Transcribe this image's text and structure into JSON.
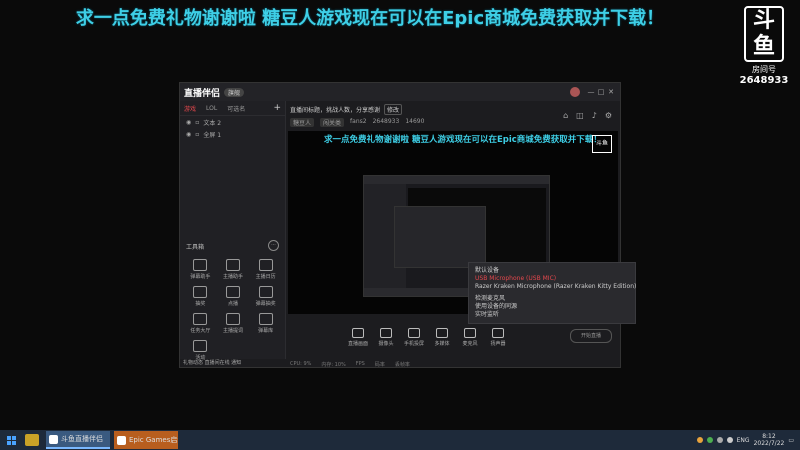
{
  "banner": "求一点免费礼物谢谢啦 糖豆人游戏现在可以在Epic商城免费获取并下载！",
  "logo": {
    "mark": "斗鱼",
    "room_label": "房间号",
    "room_number": "2648933"
  },
  "app": {
    "name": "直播伴侣",
    "badge": "旗舰",
    "left_tabs": [
      "游戏",
      "LOL",
      "可选名"
    ],
    "add": "+",
    "sources": [
      {
        "name": "文本 2"
      },
      {
        "name": "全屏 1"
      }
    ],
    "tools_title": "工具箱",
    "tools": [
      "弹幕助手",
      "主播助手",
      "主播日历",
      "抽奖",
      "点播",
      "弹幕抽奖",
      "任务大厅",
      "主播提词",
      "弹幕库",
      "活动",
      "",
      ""
    ],
    "left_notice": "礼物动态 直播间在线 通知",
    "info": {
      "title": "直播间标题，挑战人数，分享感谢",
      "edit": "修改",
      "tags": [
        "糖豆人",
        "闯关类"
      ],
      "meta": [
        "fans2",
        "2648933",
        "14690"
      ]
    },
    "preview_title": "求一点免费礼物谢谢啦 糖豆人游戏现在可以在Epic商城免费获取并下载！",
    "preview_logo": "斗鱼",
    "toolbar": [
      "直播画面",
      "摄像头",
      "手机投屏",
      "多媒体",
      "麦克风",
      "扬声器"
    ],
    "start_label": "开始直播",
    "status": [
      "CPU: 9%",
      "内存: 10%",
      "FPS",
      "码率",
      "丢帧率"
    ],
    "menu": {
      "items": [
        "默认设备",
        "USB Microphone (USB MIC)",
        "Razer Kraken Microphone (Razer Kraken Kitty Edition)",
        "",
        "检测麦克风",
        "使用设备的同源",
        "实时监听"
      ]
    }
  },
  "taskbar": {
    "tasks": [
      "斗鱼直播伴侣",
      "Epic Games启动..."
    ],
    "lang": "ENG",
    "time": "8:12",
    "date": "2022/7/22"
  }
}
